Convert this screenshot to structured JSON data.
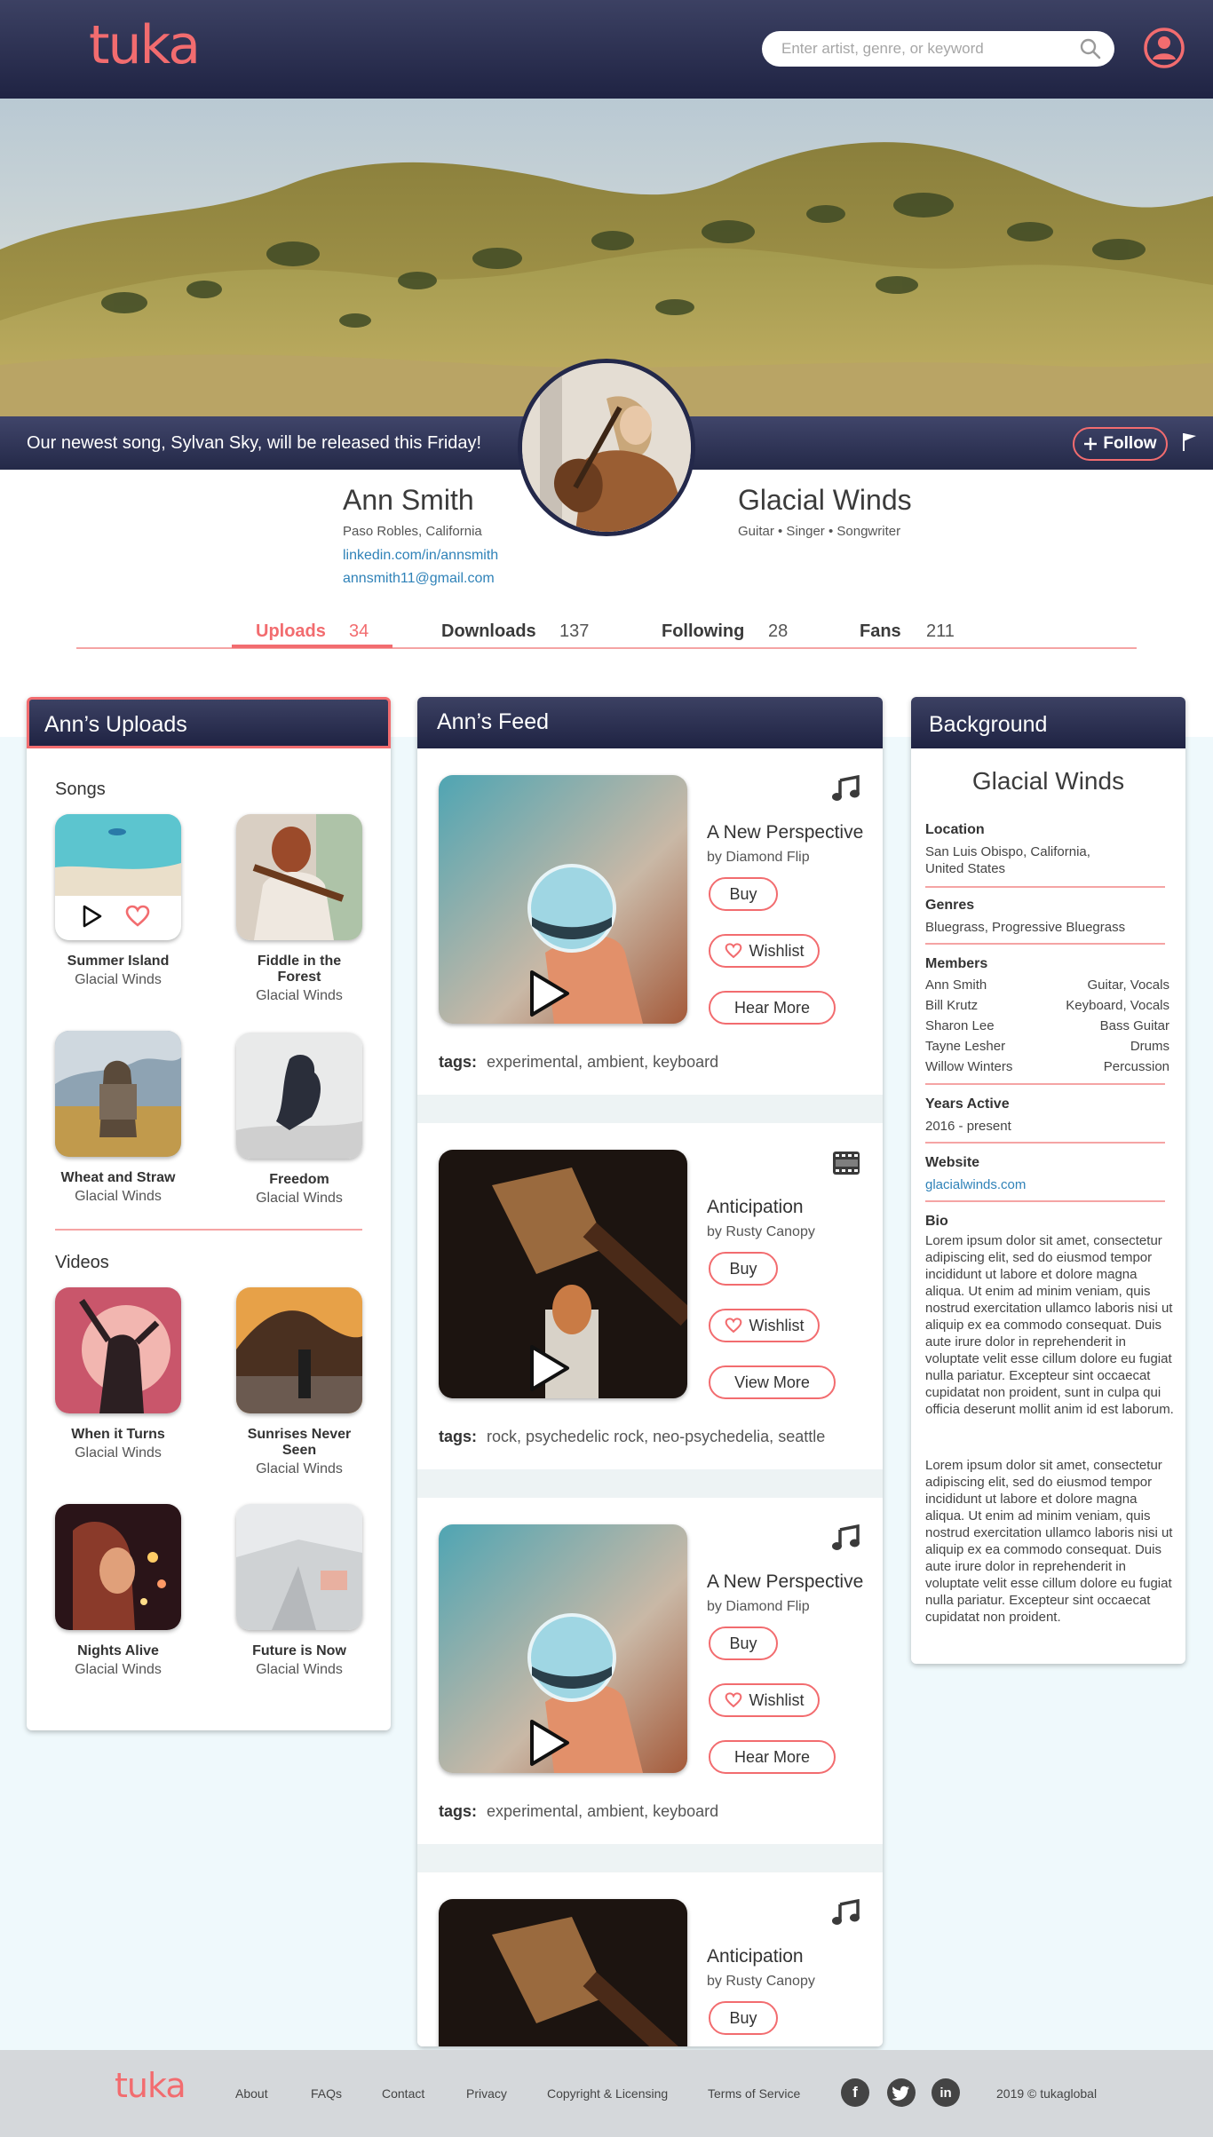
{
  "header": {
    "logo": "tuka",
    "search_placeholder": "Enter artist, genre, or keyword"
  },
  "banner": {
    "announcement": "Our newest song, Sylvan Sky, will be released this Friday!",
    "follow_label": "Follow"
  },
  "profile": {
    "name": "Ann Smith",
    "location": "Paso Robles, California",
    "linkedin": "linkedin.com/in/annsmith",
    "email": "annsmith11@gmail.com",
    "band": "Glacial Winds",
    "roles": "Guitar • Singer • Songwriter"
  },
  "stats": [
    {
      "label": "Uploads",
      "count": "34"
    },
    {
      "label": "Downloads",
      "count": "137"
    },
    {
      "label": "Following",
      "count": "28"
    },
    {
      "label": "Fans",
      "count": "211"
    }
  ],
  "uploads": {
    "title": "Ann’s Uploads",
    "songs_title": "Songs",
    "videos_title": "Videos",
    "songs": [
      {
        "title": "Summer Island",
        "artist": "Glacial Winds"
      },
      {
        "title": "Fiddle in the Forest",
        "artist": "Glacial Winds"
      },
      {
        "title": "Wheat and Straw",
        "artist": "Glacial Winds"
      },
      {
        "title": "Freedom",
        "artist": "Glacial Winds"
      }
    ],
    "videos": [
      {
        "title": "When it Turns",
        "artist": "Glacial Winds"
      },
      {
        "title": "Sunrises Never Seen",
        "artist": "Glacial Winds"
      },
      {
        "title": "Nights Alive",
        "artist": "Glacial Winds"
      },
      {
        "title": "Future is Now",
        "artist": "Glacial Winds"
      }
    ]
  },
  "feed": {
    "title": "Ann’s Feed",
    "tags_label": "tags:",
    "buy_label": "Buy",
    "wishlist_label": "Wishlist",
    "items": [
      {
        "title": "A New Perspective",
        "by": "by Diamond Flip",
        "action": "Hear More",
        "tags": "experimental, ambient, keyboard",
        "type_icon": "music-note-icon"
      },
      {
        "title": "Anticipation",
        "by": "by Rusty Canopy",
        "action": "View More",
        "tags": "rock, psychedelic rock, neo-psychedelia, seattle",
        "type_icon": "film-icon"
      },
      {
        "title": "A New Perspective",
        "by": "by Diamond Flip",
        "action": "Hear More",
        "tags": "experimental, ambient, keyboard",
        "type_icon": "music-note-icon"
      },
      {
        "title": "Anticipation",
        "by": "by Rusty Canopy",
        "action": "",
        "tags": "",
        "type_icon": "music-note-icon"
      }
    ]
  },
  "background": {
    "title": "Background",
    "band": "Glacial Winds",
    "location_label": "Location",
    "location": "San Luis Obispo, California, United States",
    "genres_label": "Genres",
    "genres": "Bluegrass, Progressive Bluegrass",
    "members_label": "Members",
    "members": [
      {
        "name": "Ann Smith",
        "role": "Guitar, Vocals"
      },
      {
        "name": "Bill Krutz",
        "role": "Keyboard, Vocals"
      },
      {
        "name": "Sharon Lee",
        "role": "Bass Guitar"
      },
      {
        "name": "Tayne Lesher",
        "role": "Drums"
      },
      {
        "name": "Willow Winters",
        "role": "Percussion"
      }
    ],
    "years_label": "Years Active",
    "years": "2016 - present",
    "website_label": "Website",
    "website": "glacialwinds.com",
    "bio_label": "Bio",
    "bio_1": "Lorem ipsum dolor sit amet, consectetur adipiscing elit, sed do eiusmod tempor incididunt ut labore et dolore magna aliqua. Ut enim ad minim veniam, quis nostrud exercitation ullamco laboris nisi ut aliquip ex ea commodo consequat. Duis aute irure dolor in reprehenderit in voluptate velit esse cillum dolore eu fugiat nulla pariatur. Excepteur sint occaecat cupidatat non proident, sunt in culpa qui officia deserunt mollit anim id est laborum.",
    "bio_2": "Lorem ipsum dolor sit amet, consectetur adipiscing elit, sed do eiusmod tempor incididunt ut labore et dolore magna aliqua. Ut enim ad minim veniam, quis nostrud exercitation ullamco laboris nisi ut aliquip ex ea commodo consequat. Duis aute irure dolor in reprehenderit in voluptate velit esse cillum dolore eu fugiat nulla pariatur. Excepteur sint occaecat cupidatat non proident."
  },
  "footer": {
    "logo": "tuka",
    "links": [
      "About",
      "FAQs",
      "Contact",
      "Privacy",
      "Copyright & Licensing",
      "Terms of Service"
    ],
    "social": [
      "f",
      "t",
      "in"
    ],
    "copyright": "2019 © tukaglobal"
  },
  "colors": {
    "accent": "#f26c6f",
    "navy": "#23284a",
    "link": "#2f82b8"
  }
}
